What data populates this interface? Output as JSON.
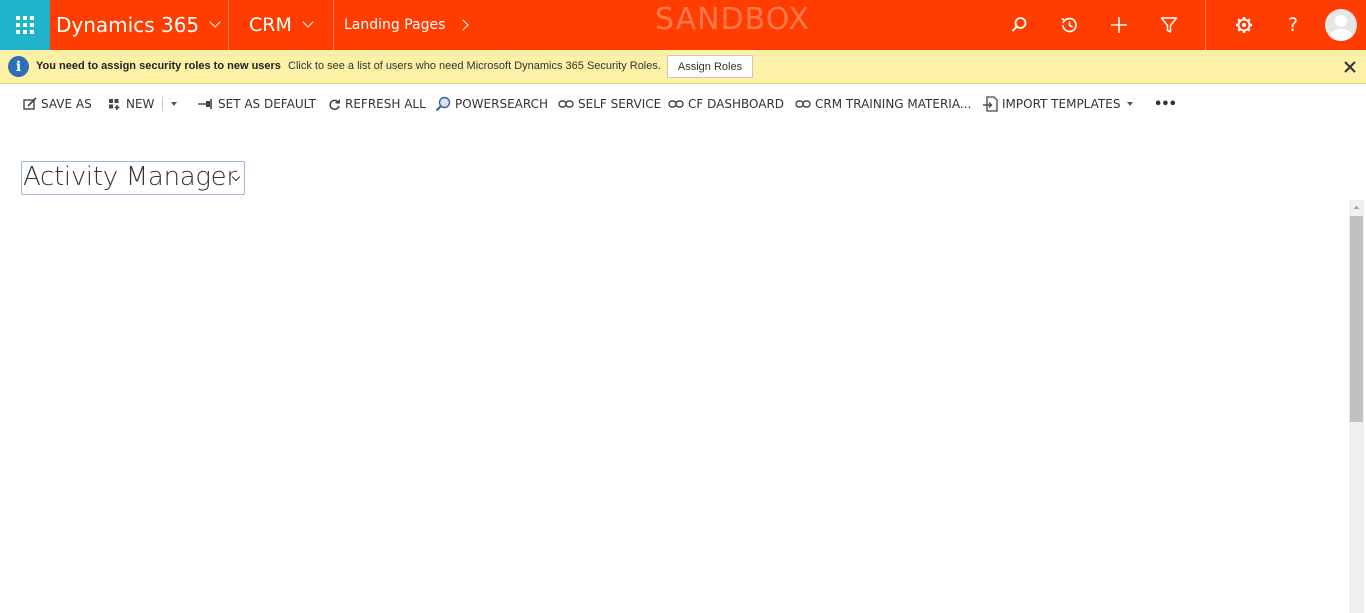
{
  "topbar": {
    "app_name": "Dynamics 365",
    "module": "CRM",
    "area": "Landing Pages",
    "environment_label": "SANDBOX",
    "icons": [
      "search-icon",
      "history-icon",
      "plus-icon",
      "filter-icon",
      "gear-icon",
      "help-icon"
    ],
    "help_label": "?",
    "brand_color": "#ff3d00",
    "waffle_color": "#1fb4c9"
  },
  "notification": {
    "title": "You need to assign security roles to new users",
    "message": "Click to see a list of users who need Microsoft Dynamics 365 Security Roles.",
    "button_label": "Assign Roles",
    "info_glyph": "i",
    "background": "#fcf1a6"
  },
  "command_bar": {
    "save_as": "SAVE AS",
    "new": "NEW",
    "set_as_default": "SET AS DEFAULT",
    "refresh_all": "REFRESH ALL",
    "powersearch": "POWERSEARCH",
    "self_service": "SELF SERVICE",
    "cf_dashboard": "CF DASHBOARD",
    "crm_training": "CRM TRAINING MATERIA...",
    "import_templates": "IMPORT TEMPLATES",
    "more": "•••"
  },
  "view": {
    "title": "Activity Manager"
  }
}
